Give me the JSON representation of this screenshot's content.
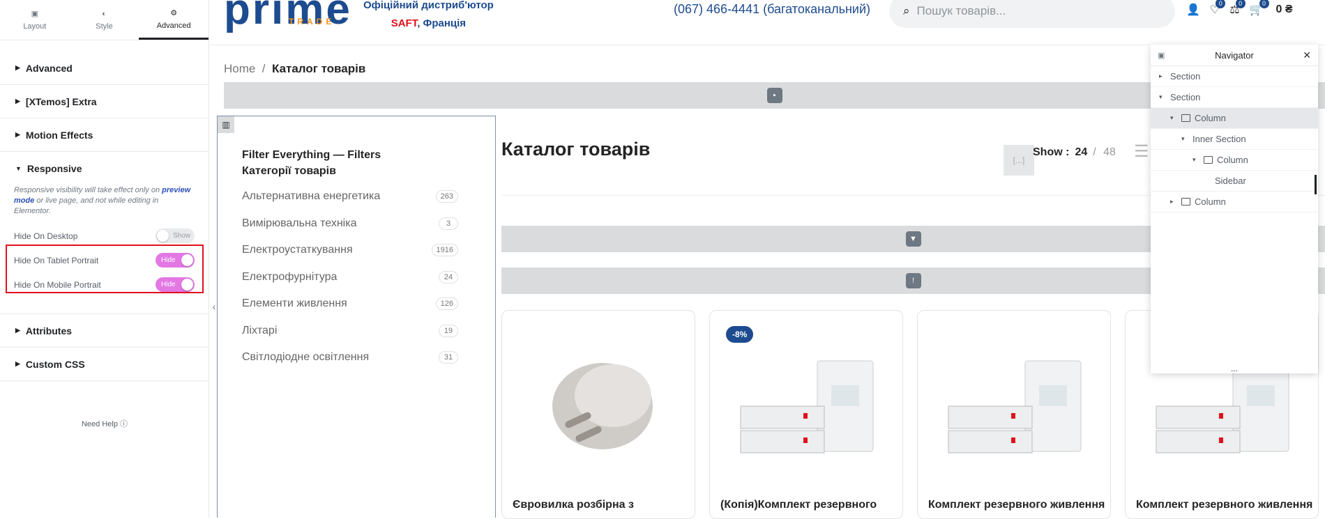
{
  "panel": {
    "tabs": [
      {
        "label": "Layout",
        "icon": "layout-icon"
      },
      {
        "label": "Style",
        "icon": "contrast-icon"
      },
      {
        "label": "Advanced",
        "icon": "gear-icon"
      }
    ],
    "sections": {
      "advanced": "Advanced",
      "extra": "[XTemos] Extra",
      "motion": "Motion Effects",
      "responsive": "Responsive",
      "attributes": "Attributes",
      "css": "Custom CSS"
    },
    "note": {
      "a": "Responsive visibility will take effect only on ",
      "link1": "preview",
      "link2": "mode",
      "b": " or live page, and not while editing in Elementor."
    },
    "controls": [
      {
        "label": "Hide On Desktop",
        "state": "Show"
      },
      {
        "label": "Hide On Tablet Portrait",
        "state": "Hide"
      },
      {
        "label": "Hide On Mobile Portrait",
        "state": "Hide"
      }
    ],
    "help": "Need Help"
  },
  "header": {
    "logo": "prime",
    "logo_sub": "TRADE",
    "dist_line1": "Офіційний дистриб'ютор",
    "dist_saft": "SAFT",
    "dist_rest": ", Франція",
    "phone": "(067) 466-4441 (багатоканальний)",
    "search_placeholder": "Пошук товарів...",
    "wish_count": "0",
    "compare_count": "0",
    "cart_count": "0",
    "cart_total": "0 ₴"
  },
  "breadcrumb": {
    "home": "Home",
    "current": "Каталог товарів"
  },
  "sidebar": {
    "title_line1": "Filter Everything — Filters",
    "title_line2": "Категорії товарів",
    "categories": [
      {
        "name": "Альтернативна енергетика",
        "count": "263"
      },
      {
        "name": "Вимірювальна техніка",
        "count": "3"
      },
      {
        "name": "Електроустаткування",
        "count": "1916"
      },
      {
        "name": "Електрофурнітура",
        "count": "24"
      },
      {
        "name": "Елементи живлення",
        "count": "126"
      },
      {
        "name": "Ліхтарі",
        "count": "19"
      },
      {
        "name": "Світлодіодне освітлення",
        "count": "31"
      }
    ]
  },
  "catalog": {
    "title": "Каталог товарів",
    "dots": "[...]",
    "show_label": "Show :",
    "show_24": "24",
    "show_sep": "/",
    "show_48": "48",
    "products": [
      {
        "title": "Євровилка розбірна з",
        "badge": ""
      },
      {
        "title": "(Копія)Комплект резервного",
        "badge": "-8%"
      },
      {
        "title": "Комплект резервного живлення",
        "badge": ""
      },
      {
        "title": "Комплект резервного живлення",
        "badge": ""
      }
    ]
  },
  "navigator": {
    "title": "Navigator",
    "items": [
      {
        "label": "Section",
        "depth": 0,
        "toggle": "▸",
        "col": false
      },
      {
        "label": "Section",
        "depth": 0,
        "toggle": "▾",
        "col": false
      },
      {
        "label": "Column",
        "depth": 1,
        "toggle": "▾",
        "col": true,
        "sel": true
      },
      {
        "label": "Inner Section",
        "depth": 2,
        "toggle": "▾",
        "col": false
      },
      {
        "label": "Column",
        "depth": 3,
        "toggle": "▾",
        "col": true
      },
      {
        "label": "Sidebar",
        "depth": 4,
        "toggle": "",
        "col": false
      },
      {
        "label": "Column",
        "depth": 1,
        "toggle": "▸",
        "col": true
      }
    ],
    "footer": "..."
  },
  "colors": {
    "accent": "#1d4b8f",
    "toggle_on": "#e377e3",
    "highlight": "#e0101c"
  }
}
